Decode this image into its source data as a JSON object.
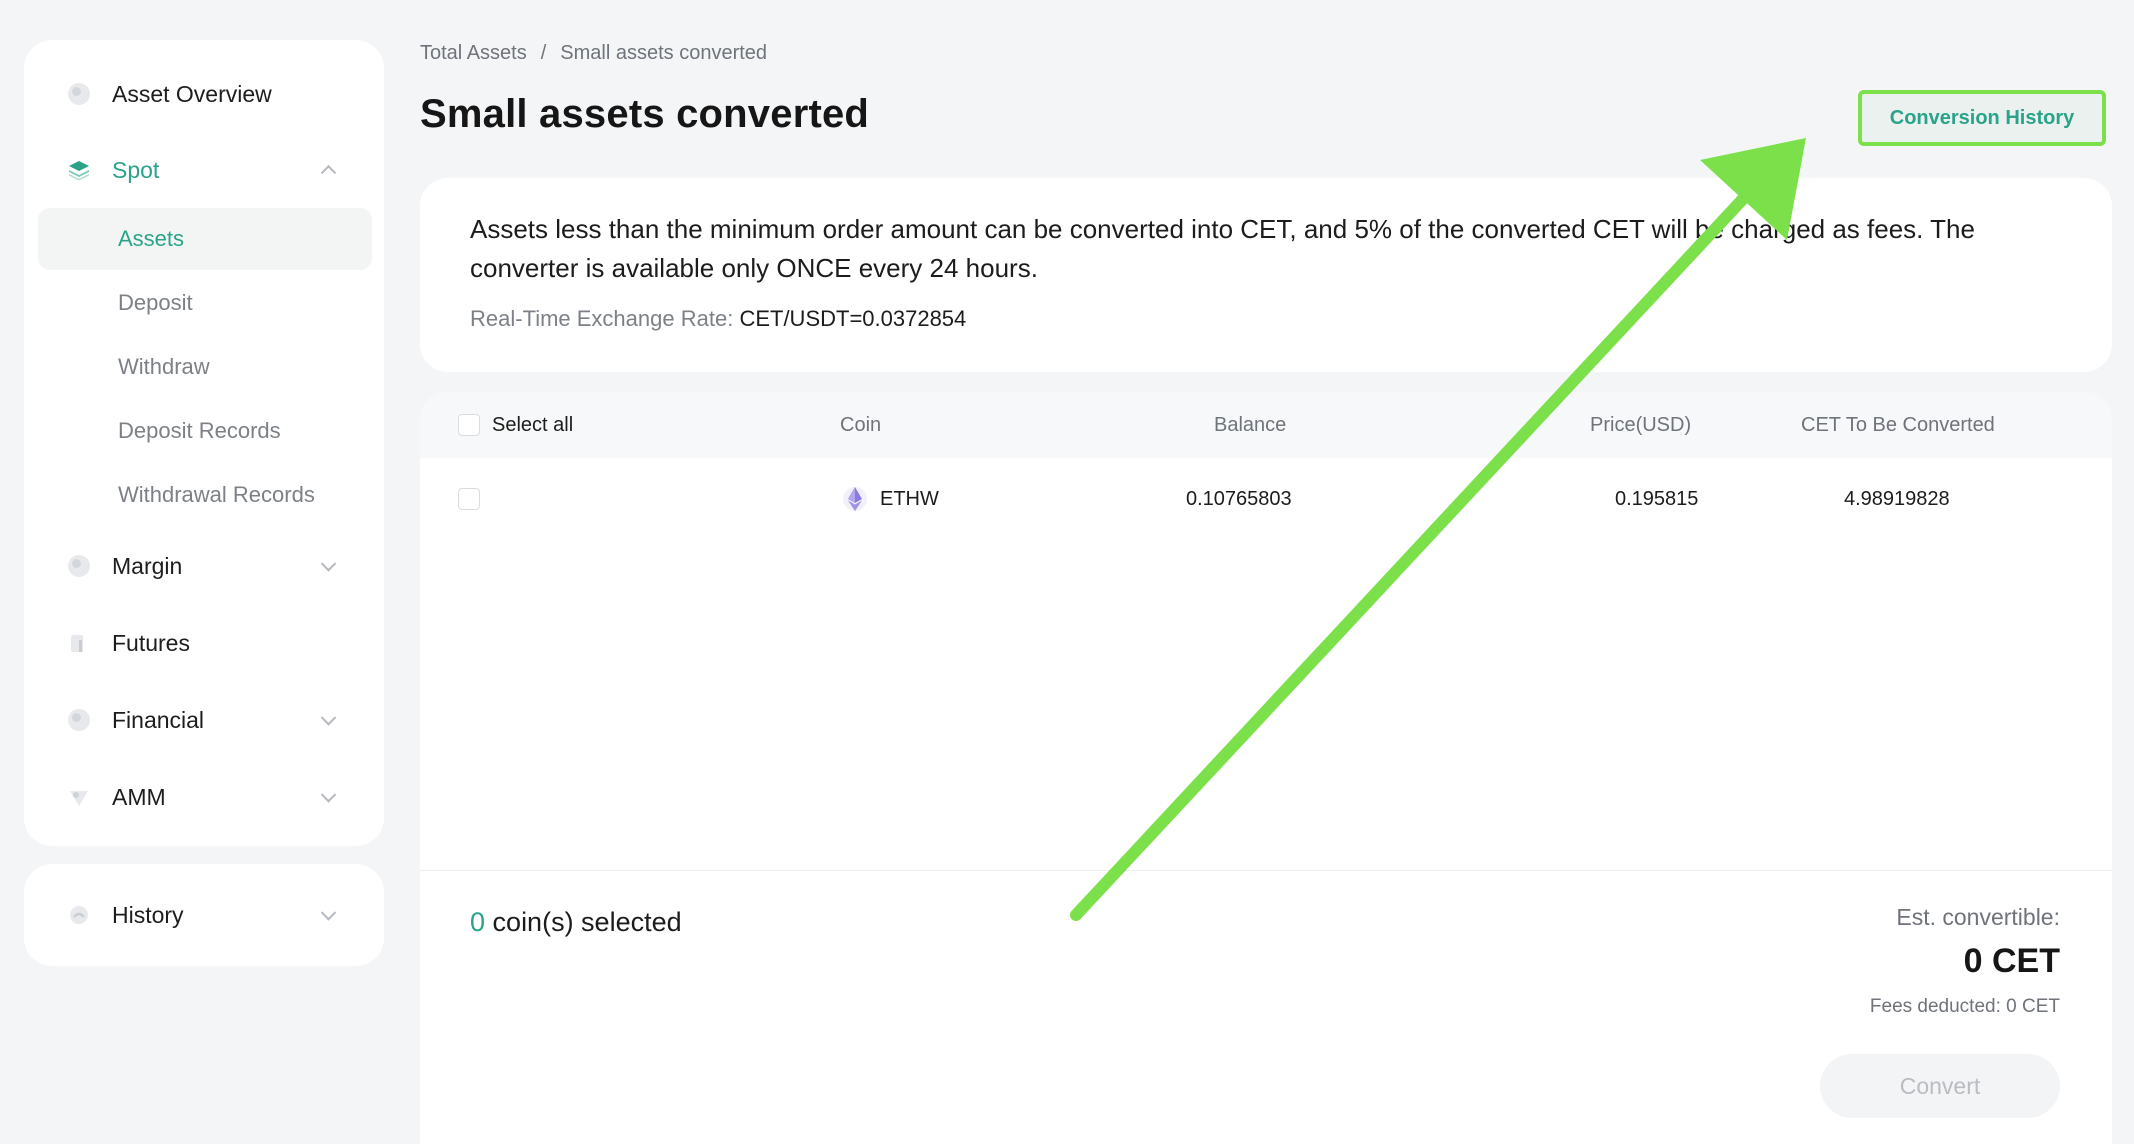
{
  "sidebar": {
    "items": [
      {
        "label": "Asset Overview",
        "icon": "pie-chart-icon"
      },
      {
        "label": "Spot",
        "icon": "layers-icon",
        "expanded": true
      },
      {
        "label": "Margin",
        "icon": "margin-icon"
      },
      {
        "label": "Futures",
        "icon": "futures-icon"
      },
      {
        "label": "Financial",
        "icon": "financial-icon"
      },
      {
        "label": "AMM",
        "icon": "amm-icon"
      }
    ],
    "spot_sub": [
      {
        "label": "Assets",
        "active": true
      },
      {
        "label": "Deposit"
      },
      {
        "label": "Withdraw"
      },
      {
        "label": "Deposit Records"
      },
      {
        "label": "Withdrawal Records"
      }
    ],
    "history": {
      "label": "History",
      "icon": "history-icon"
    }
  },
  "breadcrumb": {
    "root": "Total Assets",
    "separator": "/",
    "current": "Small assets converted"
  },
  "page_title": "Small assets converted",
  "conversion_history_label": "Conversion History",
  "info": {
    "text": "Assets less than the minimum order amount can be converted into CET, and 5% of the converted CET will be charged as fees. The converter is available only ONCE every 24 hours.",
    "rate_label": "Real-Time Exchange Rate:",
    "rate_value": "CET/USDT=0.0372854"
  },
  "table": {
    "select_all": "Select all",
    "columns": {
      "coin": "Coin",
      "balance": "Balance",
      "price": "Price(USD)",
      "cet": "CET To Be Converted"
    },
    "rows": [
      {
        "coin": "ETHW",
        "icon": "ethereum-icon",
        "balance": "0.10765803",
        "price": "0.195815",
        "cet": "4.98919828"
      }
    ]
  },
  "footer": {
    "selected_num": "0",
    "selected_label": "coin(s) selected",
    "est_label": "Est. convertible:",
    "est_value": "0 CET",
    "fees": "Fees deducted: 0 CET",
    "convert_label": "Convert"
  },
  "colors": {
    "accent": "#2aa38a",
    "arrow": "#7ce04a",
    "background": "#f4f5f7"
  }
}
